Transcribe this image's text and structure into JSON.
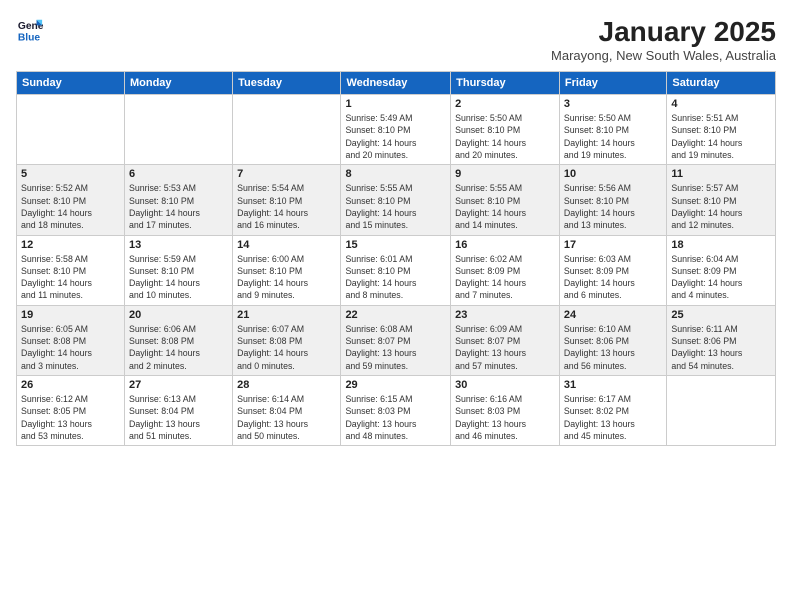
{
  "logo": {
    "line1": "General",
    "line2": "Blue"
  },
  "title": "January 2025",
  "subtitle": "Marayong, New South Wales, Australia",
  "weekdays": [
    "Sunday",
    "Monday",
    "Tuesday",
    "Wednesday",
    "Thursday",
    "Friday",
    "Saturday"
  ],
  "weeks": [
    [
      {
        "day": "",
        "info": ""
      },
      {
        "day": "",
        "info": ""
      },
      {
        "day": "",
        "info": ""
      },
      {
        "day": "1",
        "info": "Sunrise: 5:49 AM\nSunset: 8:10 PM\nDaylight: 14 hours\nand 20 minutes."
      },
      {
        "day": "2",
        "info": "Sunrise: 5:50 AM\nSunset: 8:10 PM\nDaylight: 14 hours\nand 20 minutes."
      },
      {
        "day": "3",
        "info": "Sunrise: 5:50 AM\nSunset: 8:10 PM\nDaylight: 14 hours\nand 19 minutes."
      },
      {
        "day": "4",
        "info": "Sunrise: 5:51 AM\nSunset: 8:10 PM\nDaylight: 14 hours\nand 19 minutes."
      }
    ],
    [
      {
        "day": "5",
        "info": "Sunrise: 5:52 AM\nSunset: 8:10 PM\nDaylight: 14 hours\nand 18 minutes."
      },
      {
        "day": "6",
        "info": "Sunrise: 5:53 AM\nSunset: 8:10 PM\nDaylight: 14 hours\nand 17 minutes."
      },
      {
        "day": "7",
        "info": "Sunrise: 5:54 AM\nSunset: 8:10 PM\nDaylight: 14 hours\nand 16 minutes."
      },
      {
        "day": "8",
        "info": "Sunrise: 5:55 AM\nSunset: 8:10 PM\nDaylight: 14 hours\nand 15 minutes."
      },
      {
        "day": "9",
        "info": "Sunrise: 5:55 AM\nSunset: 8:10 PM\nDaylight: 14 hours\nand 14 minutes."
      },
      {
        "day": "10",
        "info": "Sunrise: 5:56 AM\nSunset: 8:10 PM\nDaylight: 14 hours\nand 13 minutes."
      },
      {
        "day": "11",
        "info": "Sunrise: 5:57 AM\nSunset: 8:10 PM\nDaylight: 14 hours\nand 12 minutes."
      }
    ],
    [
      {
        "day": "12",
        "info": "Sunrise: 5:58 AM\nSunset: 8:10 PM\nDaylight: 14 hours\nand 11 minutes."
      },
      {
        "day": "13",
        "info": "Sunrise: 5:59 AM\nSunset: 8:10 PM\nDaylight: 14 hours\nand 10 minutes."
      },
      {
        "day": "14",
        "info": "Sunrise: 6:00 AM\nSunset: 8:10 PM\nDaylight: 14 hours\nand 9 minutes."
      },
      {
        "day": "15",
        "info": "Sunrise: 6:01 AM\nSunset: 8:10 PM\nDaylight: 14 hours\nand 8 minutes."
      },
      {
        "day": "16",
        "info": "Sunrise: 6:02 AM\nSunset: 8:09 PM\nDaylight: 14 hours\nand 7 minutes."
      },
      {
        "day": "17",
        "info": "Sunrise: 6:03 AM\nSunset: 8:09 PM\nDaylight: 14 hours\nand 6 minutes."
      },
      {
        "day": "18",
        "info": "Sunrise: 6:04 AM\nSunset: 8:09 PM\nDaylight: 14 hours\nand 4 minutes."
      }
    ],
    [
      {
        "day": "19",
        "info": "Sunrise: 6:05 AM\nSunset: 8:08 PM\nDaylight: 14 hours\nand 3 minutes."
      },
      {
        "day": "20",
        "info": "Sunrise: 6:06 AM\nSunset: 8:08 PM\nDaylight: 14 hours\nand 2 minutes."
      },
      {
        "day": "21",
        "info": "Sunrise: 6:07 AM\nSunset: 8:08 PM\nDaylight: 14 hours\nand 0 minutes."
      },
      {
        "day": "22",
        "info": "Sunrise: 6:08 AM\nSunset: 8:07 PM\nDaylight: 13 hours\nand 59 minutes."
      },
      {
        "day": "23",
        "info": "Sunrise: 6:09 AM\nSunset: 8:07 PM\nDaylight: 13 hours\nand 57 minutes."
      },
      {
        "day": "24",
        "info": "Sunrise: 6:10 AM\nSunset: 8:06 PM\nDaylight: 13 hours\nand 56 minutes."
      },
      {
        "day": "25",
        "info": "Sunrise: 6:11 AM\nSunset: 8:06 PM\nDaylight: 13 hours\nand 54 minutes."
      }
    ],
    [
      {
        "day": "26",
        "info": "Sunrise: 6:12 AM\nSunset: 8:05 PM\nDaylight: 13 hours\nand 53 minutes."
      },
      {
        "day": "27",
        "info": "Sunrise: 6:13 AM\nSunset: 8:04 PM\nDaylight: 13 hours\nand 51 minutes."
      },
      {
        "day": "28",
        "info": "Sunrise: 6:14 AM\nSunset: 8:04 PM\nDaylight: 13 hours\nand 50 minutes."
      },
      {
        "day": "29",
        "info": "Sunrise: 6:15 AM\nSunset: 8:03 PM\nDaylight: 13 hours\nand 48 minutes."
      },
      {
        "day": "30",
        "info": "Sunrise: 6:16 AM\nSunset: 8:03 PM\nDaylight: 13 hours\nand 46 minutes."
      },
      {
        "day": "31",
        "info": "Sunrise: 6:17 AM\nSunset: 8:02 PM\nDaylight: 13 hours\nand 45 minutes."
      },
      {
        "day": "",
        "info": ""
      }
    ]
  ]
}
